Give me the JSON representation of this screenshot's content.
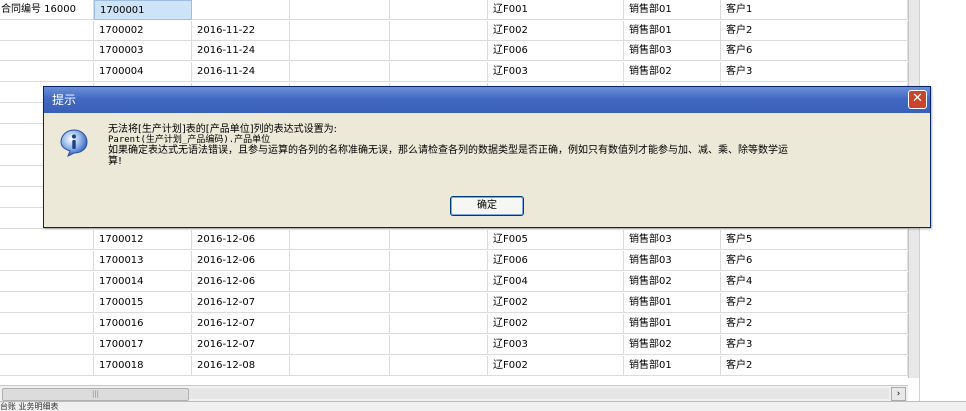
{
  "grid": {
    "rows": [
      {
        "label": "合同编号  16000",
        "id": "1700001",
        "date": "",
        "blank": "",
        "code": "辽F001",
        "dept": "销售部01",
        "customer": "客户1"
      },
      {
        "label": "",
        "id": "1700002",
        "date": "2016-11-22",
        "blank": "",
        "code": "辽F002",
        "dept": "销售部01",
        "customer": "客户2"
      },
      {
        "label": "",
        "id": "1700003",
        "date": "2016-11-24",
        "blank": "",
        "code": "辽F006",
        "dept": "销售部03",
        "customer": "客户6"
      },
      {
        "label": "",
        "id": "1700004",
        "date": "2016-11-24",
        "blank": "",
        "code": "辽F003",
        "dept": "销售部02",
        "customer": "客户3"
      },
      {
        "label": "",
        "id": "1700012",
        "date": "2016-12-06",
        "blank": "",
        "code": "辽F005",
        "dept": "销售部03",
        "customer": "客户5"
      },
      {
        "label": "",
        "id": "1700013",
        "date": "2016-12-06",
        "blank": "",
        "code": "辽F006",
        "dept": "销售部03",
        "customer": "客户6"
      },
      {
        "label": "",
        "id": "1700014",
        "date": "2016-12-06",
        "blank": "",
        "code": "辽F004",
        "dept": "销售部02",
        "customer": "客户4"
      },
      {
        "label": "",
        "id": "1700015",
        "date": "2016-12-07",
        "blank": "",
        "code": "辽F002",
        "dept": "销售部01",
        "customer": "客户2"
      },
      {
        "label": "",
        "id": "1700016",
        "date": "2016-12-07",
        "blank": "",
        "code": "辽F002",
        "dept": "销售部01",
        "customer": "客户2"
      },
      {
        "label": "",
        "id": "1700017",
        "date": "2016-12-07",
        "blank": "",
        "code": "辽F003",
        "dept": "销售部02",
        "customer": "客户3"
      },
      {
        "label": "",
        "id": "1700018",
        "date": "2016-12-08",
        "blank": "",
        "code": "辽F002",
        "dept": "销售部01",
        "customer": "客户2"
      }
    ]
  },
  "dialog": {
    "title": "提示",
    "close_glyph": "✕",
    "line1": "无法将[生产计划]表的[产品单位]列的表达式设置为:",
    "line2": "Parent(生产计划_产品编码).产品单位",
    "line3": "如果确定表达式无语法错误，且参与运算的各列的名称准确无误，那么请检查各列的数据类型是否正确，例如只有数值列才能参与加、减、乘、除等数学运",
    "line4": "算!",
    "ok_label": "确定",
    "icon": "info-icon"
  },
  "scrollbar": {
    "thumb_glyph": "|||",
    "right_arrow": "›"
  },
  "bottom": {
    "label": "台账  业务明细表"
  },
  "colors": {
    "title_bar": "#4169c2",
    "selection": "#cde3f7",
    "close_button": "#c8452b",
    "dialog_bg": "#ece9d8"
  }
}
